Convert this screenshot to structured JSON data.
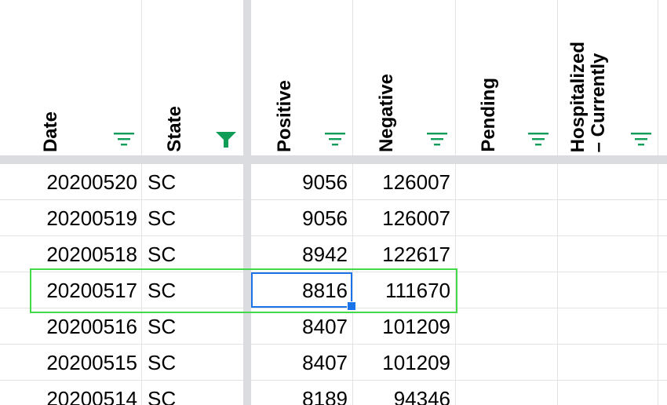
{
  "columns": [
    {
      "label": "Date"
    },
    {
      "label": "State"
    },
    {
      "label": "Positive"
    },
    {
      "label": "Negative"
    },
    {
      "label": "Pending"
    },
    {
      "label": "Hospitalized\n– Currently"
    }
  ],
  "rows": [
    {
      "date": "20200520",
      "state": "SC",
      "positive": "9056",
      "negative": "126007"
    },
    {
      "date": "20200519",
      "state": "SC",
      "positive": "9056",
      "negative": "126007"
    },
    {
      "date": "20200518",
      "state": "SC",
      "positive": "8942",
      "negative": "122617"
    },
    {
      "date": "20200517",
      "state": "SC",
      "positive": "8816",
      "negative": "111670"
    },
    {
      "date": "20200516",
      "state": "SC",
      "positive": "8407",
      "negative": "101209"
    },
    {
      "date": "20200515",
      "state": "SC",
      "positive": "8407",
      "negative": "101209"
    },
    {
      "date": "20200514",
      "state": "SC",
      "positive": "8189",
      "negative": "94346"
    }
  ],
  "colors": {
    "filter_icon": "#0f9d58",
    "selection": "#1a73e8",
    "row_highlight": "#43d94a"
  },
  "icons": {
    "filter": "filter-icon",
    "filter_active": "filter-active-icon"
  }
}
